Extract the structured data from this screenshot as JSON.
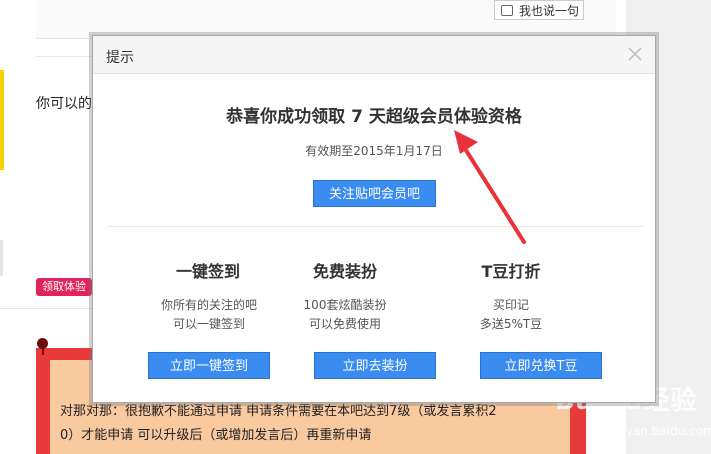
{
  "background": {
    "reply_button": "我也说一句",
    "content_text_1": "你可以的",
    "tag_label": "领取体验",
    "content_text_2": "对那对那：很抱歉不能通过申请 申请条件需要在本吧达到7级（或发言累积2",
    "content_text_3": "0）才能申请 可以升级后（或增加发言后）再重新申请",
    "watermark": "Baidu经验",
    "watermark_sub": "jingyan.baidu.com"
  },
  "modal": {
    "title": "提示",
    "headline": "恭喜你成功领取 7 天超级会员体验资格",
    "validity": "有效期至2015年1月17日",
    "follow_button": "关注贴吧会员吧",
    "features": [
      {
        "title": "一键签到",
        "desc_1": "你所有的关注的吧",
        "desc_2": "可以一键签到",
        "button": "立即一键签到"
      },
      {
        "title": "免费装扮",
        "desc_1": "100套炫酷装扮",
        "desc_2": "可以免费使用",
        "button": "立即去装扮"
      },
      {
        "title": "T豆打折",
        "desc_1": "买印记",
        "desc_2": "多送5%T豆",
        "button": "立即兑换T豆"
      }
    ]
  },
  "colors": {
    "button_blue": "#3b8cf0",
    "annotation_red": "#e8323c",
    "tag_pink": "#e2245b"
  }
}
